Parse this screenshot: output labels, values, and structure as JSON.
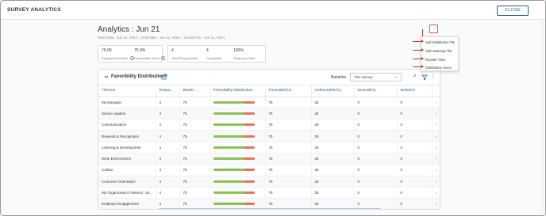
{
  "app_title": "SURVEY ANALYTICS",
  "close_label": "CLOSE",
  "analytics_title": "Analytics : Jun 21",
  "meta": {
    "start_date": "Start Date : Jun 21, 2024",
    "end_date": "End Date : Jun 21, 2024",
    "closed_on": "Closed On : Jun 21, 2024"
  },
  "stats": [
    {
      "value": "75.00",
      "label": "Engagement Index"
    },
    {
      "value": "75.0%",
      "label": "Favorability Score"
    },
    {
      "value": "4",
      "label": "Total Respondents"
    },
    {
      "value": "4",
      "label": "Completed"
    },
    {
      "value": "100%",
      "label": "Response Rate"
    }
  ],
  "panel": {
    "title": "Favoribility Distribution",
    "baseline_label": "Baseline",
    "baseline_value": "This Survey"
  },
  "table": {
    "headers": [
      "Themes",
      "Respo...",
      "Baseli...",
      "Favorability Distribution",
      "Favorable(%)",
      "Unfavorable(%)",
      "Neutral(%)",
      "Delta(%)"
    ],
    "rows": [
      {
        "theme": "My Manager",
        "resp": "4",
        "base": "75",
        "fav": "75",
        "unfav": "25",
        "neutral": "0",
        "delta": "0"
      },
      {
        "theme": "Senior Leaders",
        "resp": "4",
        "base": "75",
        "fav": "75",
        "unfav": "25",
        "neutral": "0",
        "delta": "0"
      },
      {
        "theme": "Communication",
        "resp": "4",
        "base": "75",
        "fav": "75",
        "unfav": "25",
        "neutral": "0",
        "delta": "0"
      },
      {
        "theme": "Rewards & Recognition",
        "resp": "4",
        "base": "75",
        "fav": "75",
        "unfav": "25",
        "neutral": "0",
        "delta": "0"
      },
      {
        "theme": "Learning & Development",
        "resp": "4",
        "base": "75",
        "fav": "75",
        "unfav": "25",
        "neutral": "0",
        "delta": "0"
      },
      {
        "theme": "Work Environment",
        "resp": "4",
        "base": "75",
        "fav": "75",
        "unfav": "25",
        "neutral": "0",
        "delta": "0"
      },
      {
        "theme": "Culture",
        "resp": "4",
        "base": "75",
        "fav": "75",
        "unfav": "25",
        "neutral": "0",
        "delta": "0"
      },
      {
        "theme": "Customer Orientation",
        "resp": "4",
        "base": "75",
        "fav": "75",
        "unfav": "25",
        "neutral": "0",
        "delta": "0"
      },
      {
        "theme": "My Organization's Mission, Va...",
        "resp": "4",
        "base": "75",
        "fav": "75",
        "unfav": "25",
        "neutral": "0",
        "delta": "0"
      },
      {
        "theme": "Employee Engagement",
        "resp": "4",
        "base": "75",
        "fav": "75",
        "unfav": "25",
        "neutral": "0",
        "delta": "0"
      }
    ]
  },
  "menu": {
    "items": [
      "Add Distribution Tile",
      "Add Heatmap Tile",
      "Reorder Tiles",
      "Distribution Score"
    ]
  },
  "colors": {
    "accent": "#2a5f86",
    "favorable": "#8cc152",
    "unfavorable": "#e8735e",
    "highlight": "#d9534f"
  }
}
